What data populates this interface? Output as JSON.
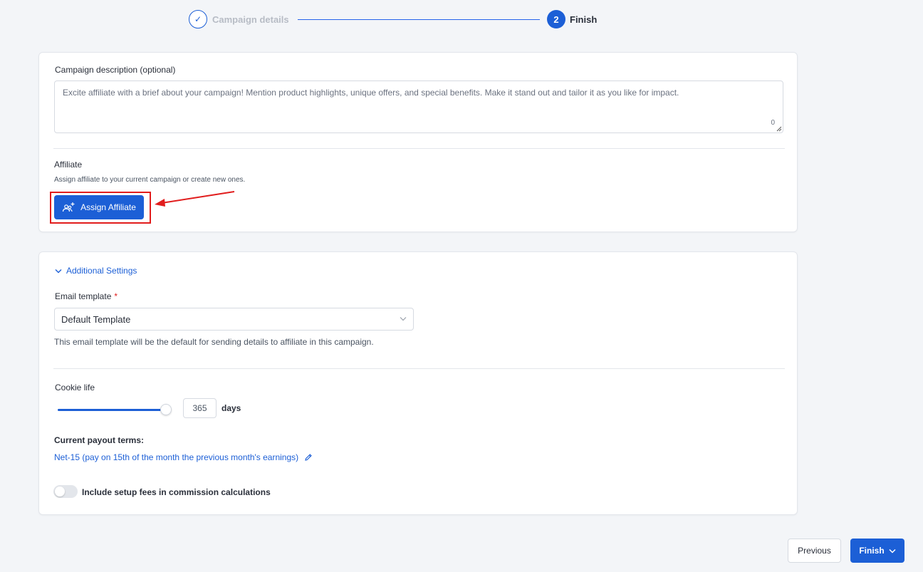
{
  "stepper": {
    "step1": {
      "icon": "check-icon",
      "label": "Campaign details",
      "status": "completed"
    },
    "step2": {
      "number": "2",
      "label": "Finish",
      "status": "active"
    }
  },
  "campaign_card": {
    "description_label": "Campaign description (optional)",
    "description_placeholder": "Excite affiliate with a brief about your campaign! Mention product highlights, unique offers, and special benefits. Make it stand out and tailor it as you like for impact.",
    "char_count": "0",
    "affiliate_title": "Affiliate",
    "affiliate_subtitle": "Assign affiliate to your current campaign or create new ones.",
    "assign_button": {
      "label": "Assign Affiliate",
      "icon": "add-user-group-icon"
    }
  },
  "settings_card": {
    "toggle_label": "Additional Settings",
    "email_template": {
      "label": "Email template",
      "required": "*",
      "selected": "Default Template",
      "help": "This email template will be the default for sending details to affiliate in this campaign."
    },
    "cookie_life": {
      "label": "Cookie life",
      "value": "365",
      "unit": "days",
      "slider_fraction": 1.0
    },
    "payout": {
      "label": "Current payout terms:",
      "value": "Net-15 (pay on 15th of the month the previous month's earnings)",
      "icon": "pencil-icon"
    },
    "setup_fees": {
      "label": "Include setup fees in commission calculations",
      "enabled": false
    }
  },
  "footer": {
    "previous_label": "Previous",
    "finish_label": "Finish"
  },
  "colors": {
    "accent": "#1c5fd6",
    "annotation": "#e11d1d",
    "background": "#f3f5f8"
  }
}
